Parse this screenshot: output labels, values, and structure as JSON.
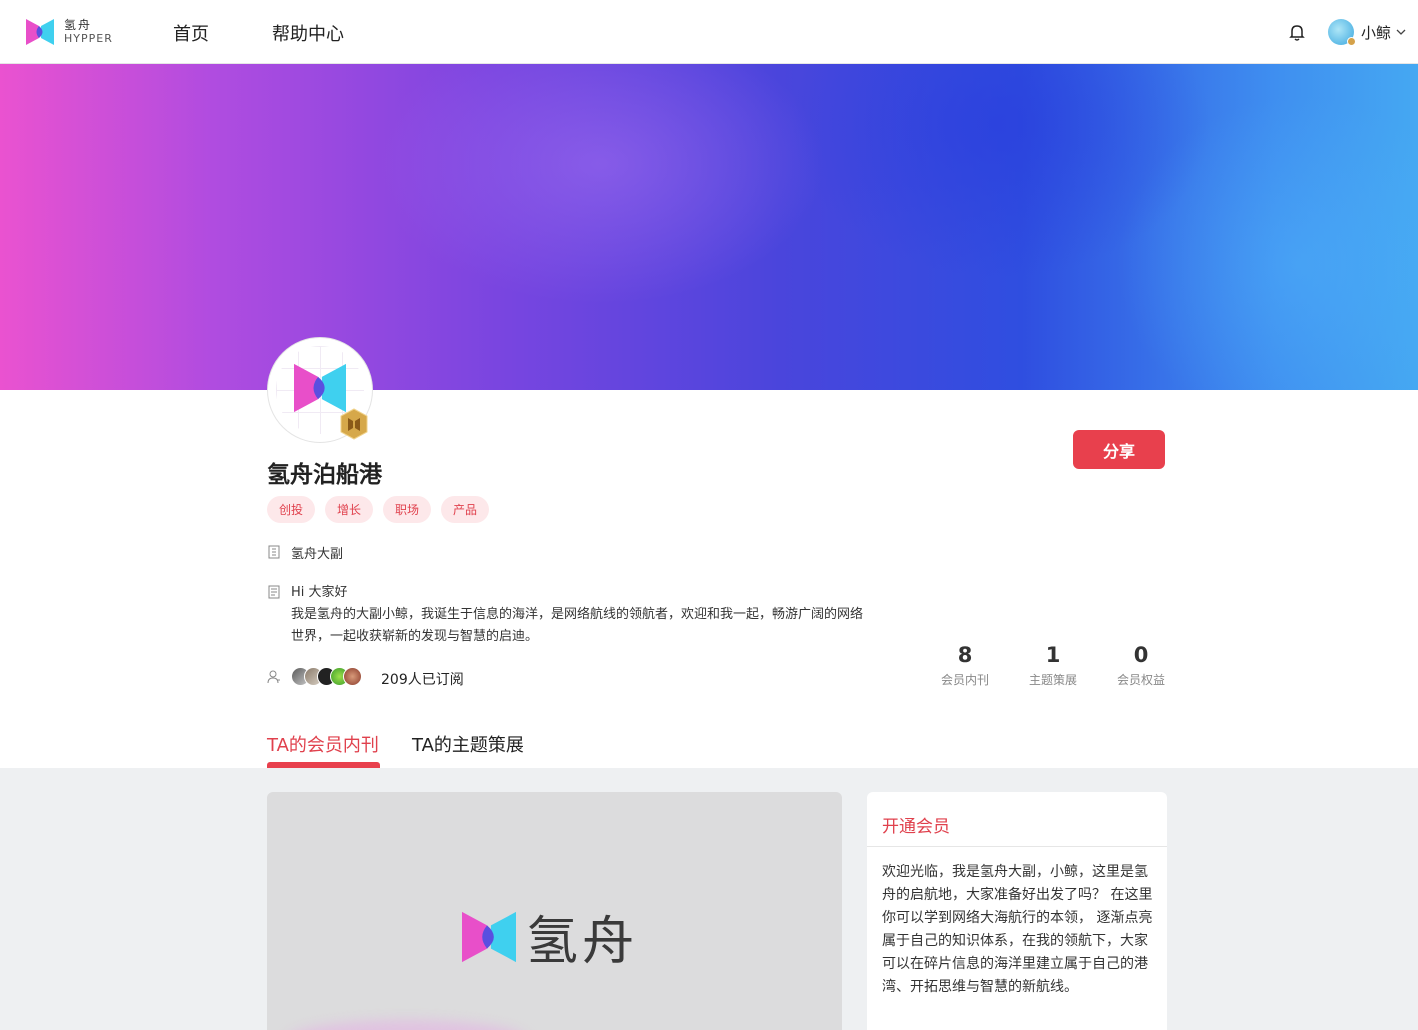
{
  "header": {
    "logo_cn": "氢舟",
    "logo_en": "HYPPER",
    "nav": [
      {
        "label": "首页"
      },
      {
        "label": "帮助中心"
      }
    ],
    "user_name": "小鲸"
  },
  "profile": {
    "name": "氢舟泊船港",
    "share_label": "分享",
    "tags": [
      "创投",
      "增长",
      "职场",
      "产品"
    ],
    "role": "氢舟大副",
    "greeting": "Hi 大家好",
    "bio": "我是氢舟的大副小鲸，我诞生于信息的海洋，是网络航线的领航者，欢迎和我一起，畅游广阔的网络世界，一起收获崭新的发现与智慧的启迪。",
    "subscribers_text": "209人已订阅",
    "stats": [
      {
        "value": "8",
        "label": "会员内刊"
      },
      {
        "value": "1",
        "label": "主题策展"
      },
      {
        "value": "0",
        "label": "会员权益"
      }
    ]
  },
  "tabs": [
    {
      "label": "TA的会员内刊"
    },
    {
      "label": "TA的主题策展"
    }
  ],
  "post": {
    "logo_text": "氢舟"
  },
  "membership": {
    "title": "开通会员",
    "text": "欢迎光临，我是氢舟大副，小鲸，这里是氢舟的启航地，大家准备好出发了吗？ 在这里你可以学到网络大海航行的本领， 逐渐点亮属于自己的知识体系，在我的领航下，大家可以在碎片信息的海洋里建立属于自己的港湾、开拓思维与智慧的新航线。"
  },
  "colors": {
    "accent": "#e8404d",
    "tag_bg": "#fde8ea",
    "logo_pink": "#e84fc9",
    "logo_cyan": "#3fd0ef"
  }
}
